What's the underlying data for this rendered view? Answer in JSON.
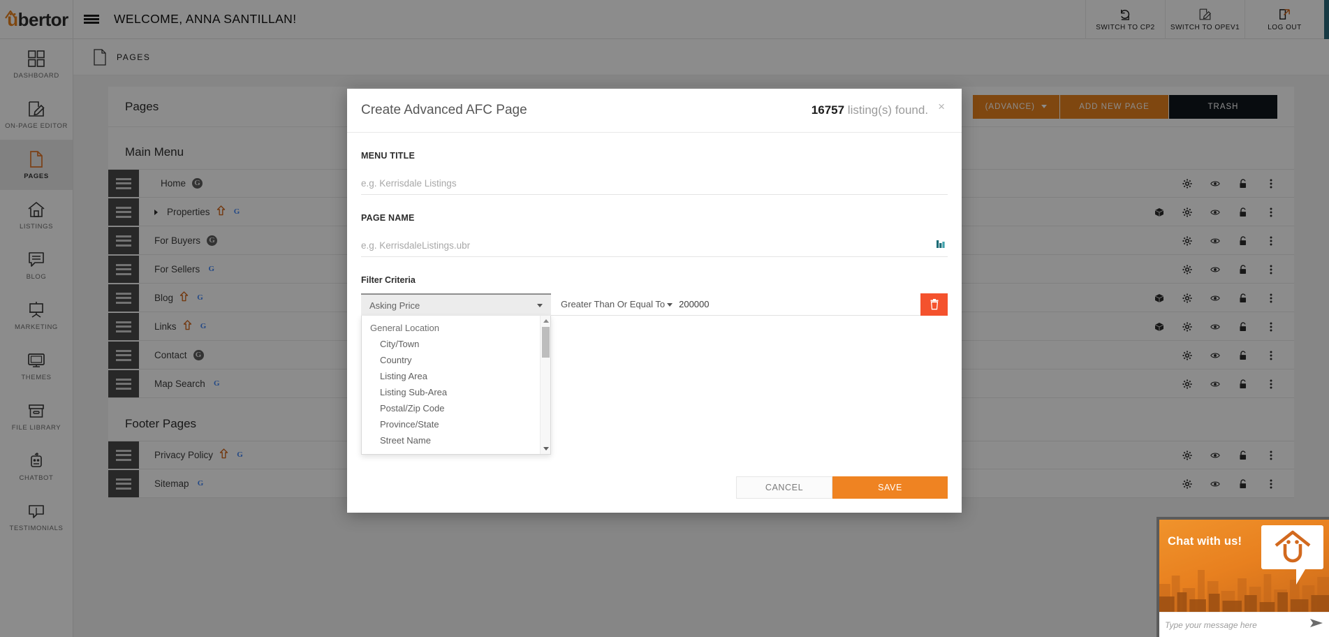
{
  "brand": {
    "name_prefix": "",
    "name_u": "ü",
    "name_rest": "bertor",
    "accent": "#e8821e"
  },
  "topbar": {
    "welcome": "WELCOME, ANNA SANTILLAN!",
    "actions": [
      {
        "label": "SWITCH TO CP2",
        "icon": "undo-icon"
      },
      {
        "label": "SWITCH TO OPEV1",
        "icon": "pencil-square-icon"
      },
      {
        "label": "LOG OUT",
        "icon": "external-link-icon"
      }
    ]
  },
  "sidebar": {
    "items": [
      {
        "label": "DASHBOARD",
        "icon": "grid-icon",
        "active": false
      },
      {
        "label": "ON-PAGE EDITOR",
        "icon": "pencil-square-icon",
        "active": false
      },
      {
        "label": "PAGES",
        "icon": "document-icon",
        "active": true
      },
      {
        "label": "LISTINGS",
        "icon": "house-icon",
        "active": false
      },
      {
        "label": "BLOG",
        "icon": "speech-bubble-icon",
        "active": false
      },
      {
        "label": "MARKETING",
        "icon": "easel-icon",
        "active": false
      },
      {
        "label": "THEMES",
        "icon": "monitor-icon",
        "active": false
      },
      {
        "label": "FILE LIBRARY",
        "icon": "file-box-icon",
        "active": false
      },
      {
        "label": "CHATBOT",
        "icon": "robot-icon",
        "active": false
      },
      {
        "label": "TESTIMONIALS",
        "icon": "quote-bubble-icon",
        "active": false
      }
    ]
  },
  "breadcrumb": {
    "label": "PAGES",
    "icon": "document-icon"
  },
  "pages_panel": {
    "title": "Pages",
    "buttons": [
      {
        "label": "(ADVANCE)",
        "style": "orange",
        "has_caret": true
      },
      {
        "label": "ADD NEW PAGE",
        "style": "orange",
        "has_caret": false
      },
      {
        "label": "TRASH",
        "style": "dark",
        "has_caret": false
      }
    ],
    "main_menu_label": "Main Menu",
    "footer_pages_label": "Footer Pages",
    "main_rows": [
      {
        "name": "Home",
        "prefix_icon": "home-icon",
        "expandable": false,
        "has_up_arrow": false,
        "google": "grey",
        "has_cube": false
      },
      {
        "name": "Properties",
        "prefix_icon": "",
        "expandable": true,
        "has_up_arrow": true,
        "google": "color",
        "has_cube": true
      },
      {
        "name": "For Buyers",
        "prefix_icon": "",
        "expandable": false,
        "has_up_arrow": false,
        "google": "grey",
        "has_cube": false
      },
      {
        "name": "For Sellers",
        "prefix_icon": "",
        "expandable": false,
        "has_up_arrow": false,
        "google": "color",
        "has_cube": false
      },
      {
        "name": "Blog",
        "prefix_icon": "",
        "expandable": false,
        "has_up_arrow": true,
        "google": "color",
        "has_cube": true
      },
      {
        "name": "Links",
        "prefix_icon": "",
        "expandable": false,
        "has_up_arrow": true,
        "google": "color",
        "has_cube": true
      },
      {
        "name": "Contact",
        "prefix_icon": "",
        "expandable": false,
        "has_up_arrow": false,
        "google": "grey",
        "has_cube": false
      },
      {
        "name": "Map Search",
        "prefix_icon": "",
        "expandable": false,
        "has_up_arrow": false,
        "google": "color",
        "has_cube": false
      }
    ],
    "footer_rows": [
      {
        "name": "Privacy Policy",
        "prefix_icon": "",
        "expandable": false,
        "has_up_arrow": true,
        "google": "color",
        "has_cube": false
      },
      {
        "name": "Sitemap",
        "prefix_icon": "",
        "expandable": false,
        "has_up_arrow": false,
        "google": "color",
        "has_cube": false
      }
    ],
    "row_action_icons": [
      "cube-icon",
      "gear-icon",
      "eye-icon",
      "lock-icon",
      "more-vertical-icon"
    ]
  },
  "modal": {
    "title": "Create Advanced AFC Page",
    "count_number": "16757",
    "count_suffix": " listing(s) found.",
    "close_label": "×",
    "menu_title_label": "MENU TITLE",
    "menu_title_value": "",
    "menu_title_placeholder": "e.g. Kerrisdale Listings",
    "page_name_label": "PAGE NAME",
    "page_name_value": "",
    "page_name_placeholder": "e.g. KerrisdaleListings.ubr",
    "page_name_icon": "bar-chart-icon",
    "filter_criteria_label": "Filter Criteria",
    "filter": {
      "field_selected": "Asking Price",
      "condition": "Greater Than Or Equal To",
      "value": "200000",
      "delete_icon": "trash-icon"
    },
    "dropdown": {
      "group_label": "General Location",
      "options": [
        "City/Town",
        "Country",
        "Listing Area",
        "Listing Sub-Area",
        "Postal/Zip Code",
        "Province/State",
        "Street Name"
      ]
    },
    "cancel_label": "CANCEL",
    "save_label": "SAVE",
    "save_color": "#ef8322"
  },
  "chat": {
    "headline": "Chat with us!",
    "input_value": "",
    "input_placeholder": "Type your message here",
    "send_icon": "send-icon"
  }
}
